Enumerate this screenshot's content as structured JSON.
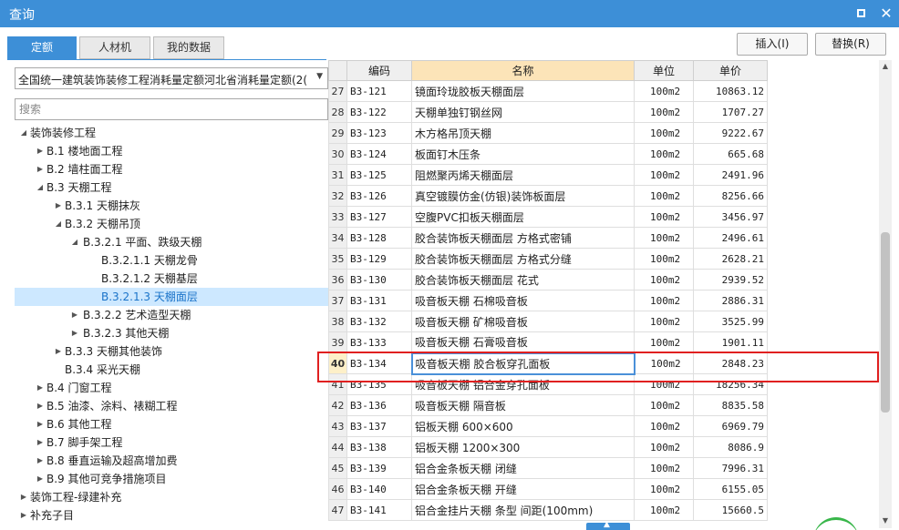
{
  "window": {
    "title": "查询"
  },
  "tabs": [
    {
      "label": "定额",
      "active": true
    },
    {
      "label": "人材机",
      "active": false
    },
    {
      "label": "我的数据",
      "active": false
    }
  ],
  "actions": {
    "insert_label": "插入(I)",
    "replace_label": "替换(R)"
  },
  "library": {
    "selected": "全国统一建筑装饰装修工程消耗量定额河北省消耗量定额(2(",
    "search_placeholder": "搜索"
  },
  "tree": [
    {
      "label": "装饰装修工程",
      "toggle": "◢",
      "indent": 0
    },
    {
      "label": "B.1 楼地面工程",
      "toggle": "▶",
      "indent": 1
    },
    {
      "label": "B.2 墙柱面工程",
      "toggle": "▶",
      "indent": 1
    },
    {
      "label": "B.3 天棚工程",
      "toggle": "◢",
      "indent": 1
    },
    {
      "label": "B.3.1 天棚抹灰",
      "toggle": "▶",
      "indent": 2
    },
    {
      "label": "B.3.2 天棚吊顶",
      "toggle": "◢",
      "indent": 2
    },
    {
      "label": "B.3.2.1 平面、跌级天棚",
      "toggle": "◢",
      "indent": 3
    },
    {
      "label": "B.3.2.1.1 天棚龙骨",
      "toggle": "",
      "indent": 4
    },
    {
      "label": "B.3.2.1.2 天棚基层",
      "toggle": "",
      "indent": 4
    },
    {
      "label": "B.3.2.1.3 天棚面层",
      "toggle": "",
      "indent": 4,
      "selected": true
    },
    {
      "label": "B.3.2.2 艺术造型天棚",
      "toggle": "▶",
      "indent": 3
    },
    {
      "label": "B.3.2.3 其他天棚",
      "toggle": "▶",
      "indent": 3
    },
    {
      "label": "B.3.3 天棚其他装饰",
      "toggle": "▶",
      "indent": 2
    },
    {
      "label": "B.3.4 采光天棚",
      "toggle": "",
      "indent": 2
    },
    {
      "label": "B.4 门窗工程",
      "toggle": "▶",
      "indent": 1
    },
    {
      "label": "B.5 油漆、涂料、裱糊工程",
      "toggle": "▶",
      "indent": 1
    },
    {
      "label": "B.6 其他工程",
      "toggle": "▶",
      "indent": 1
    },
    {
      "label": "B.7 脚手架工程",
      "toggle": "▶",
      "indent": 1
    },
    {
      "label": "B.8 垂直运输及超高增加费",
      "toggle": "▶",
      "indent": 1
    },
    {
      "label": "B.9 其他可竞争措施项目",
      "toggle": "▶",
      "indent": 1
    },
    {
      "label": "装饰工程-绿建补充",
      "toggle": "▶",
      "indent": 0
    },
    {
      "label": "补充子目",
      "toggle": "▶",
      "indent": 0
    }
  ],
  "grid": {
    "columns": [
      "编码",
      "名称",
      "单位",
      "单价"
    ],
    "rows": [
      {
        "no": "27",
        "code": "B3-121",
        "name": "镜面玲珑胶板天棚面层",
        "unit": "100m2",
        "price": "10863.12"
      },
      {
        "no": "28",
        "code": "B3-122",
        "name": "天棚单独钉钢丝网",
        "unit": "100m2",
        "price": "1707.27"
      },
      {
        "no": "29",
        "code": "B3-123",
        "name": "木方格吊顶天棚",
        "unit": "100m2",
        "price": "9222.67"
      },
      {
        "no": "30",
        "code": "B3-124",
        "name": "板面钉木压条",
        "unit": "100m2",
        "price": "665.68"
      },
      {
        "no": "31",
        "code": "B3-125",
        "name": "阻燃聚丙烯天棚面层",
        "unit": "100m2",
        "price": "2491.96"
      },
      {
        "no": "32",
        "code": "B3-126",
        "name": "真空镀膜仿金(仿银)装饰板面层",
        "unit": "100m2",
        "price": "8256.66"
      },
      {
        "no": "33",
        "code": "B3-127",
        "name": "空腹PVC扣板天棚面层",
        "unit": "100m2",
        "price": "3456.97"
      },
      {
        "no": "34",
        "code": "B3-128",
        "name": "胶合装饰板天棚面层 方格式密铺",
        "unit": "100m2",
        "price": "2496.61"
      },
      {
        "no": "35",
        "code": "B3-129",
        "name": "胶合装饰板天棚面层 方格式分缝",
        "unit": "100m2",
        "price": "2628.21"
      },
      {
        "no": "36",
        "code": "B3-130",
        "name": "胶合装饰板天棚面层 花式",
        "unit": "100m2",
        "price": "2939.52"
      },
      {
        "no": "37",
        "code": "B3-131",
        "name": "吸音板天棚 石棉吸音板",
        "unit": "100m2",
        "price": "2886.31"
      },
      {
        "no": "38",
        "code": "B3-132",
        "name": "吸音板天棚 矿棉吸音板",
        "unit": "100m2",
        "price": "3525.99"
      },
      {
        "no": "39",
        "code": "B3-133",
        "name": "吸音板天棚 石膏吸音板",
        "unit": "100m2",
        "price": "1901.11"
      },
      {
        "no": "40",
        "code": "B3-134",
        "name": "吸音板天棚 胶合板穿孔面板",
        "unit": "100m2",
        "price": "2848.23",
        "current": true
      },
      {
        "no": "41",
        "code": "B3-135",
        "name": "吸音板天棚 铝合金穿孔面板",
        "unit": "100m2",
        "price": "18256.34"
      },
      {
        "no": "42",
        "code": "B3-136",
        "name": "吸音板天棚 隔音板",
        "unit": "100m2",
        "price": "8835.58"
      },
      {
        "no": "43",
        "code": "B3-137",
        "name": "铝板天棚 600×600",
        "unit": "100m2",
        "price": "6969.79"
      },
      {
        "no": "44",
        "code": "B3-138",
        "name": "铝板天棚 1200×300",
        "unit": "100m2",
        "price": "8086.9"
      },
      {
        "no": "45",
        "code": "B3-139",
        "name": "铝合金条板天棚 闭缝",
        "unit": "100m2",
        "price": "7996.31"
      },
      {
        "no": "46",
        "code": "B3-140",
        "name": "铝合金条板天棚 开缝",
        "unit": "100m2",
        "price": "6155.05"
      },
      {
        "no": "47",
        "code": "B3-141",
        "name": "铝合金挂片天棚 条型 间距(100mm)",
        "unit": "100m2",
        "price": "15660.5"
      }
    ]
  },
  "colors": {
    "accent": "#3d8fd7",
    "highlight": "#e02020",
    "selected_row": "#cde8ff",
    "sorted_header": "#fce4b8"
  },
  "icons": {
    "maximize": "maximize-icon",
    "close": "close-icon",
    "dropdown": "chevron-down-icon"
  }
}
